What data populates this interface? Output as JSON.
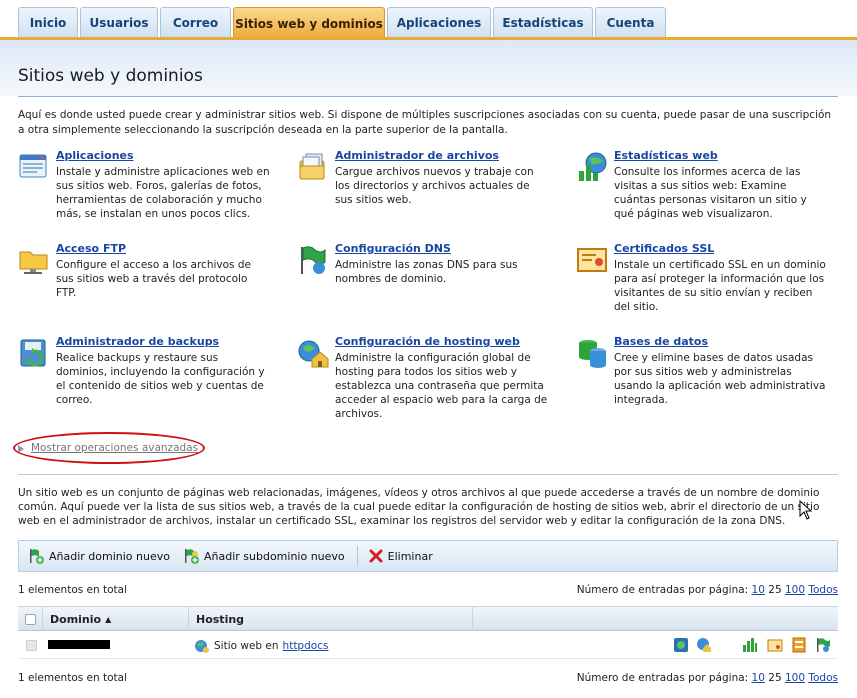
{
  "tabs": [
    {
      "label": "Inicio",
      "active": false
    },
    {
      "label": "Usuarios",
      "active": false
    },
    {
      "label": "Correo",
      "active": false
    },
    {
      "label": "Sitios web y dominios",
      "active": true
    },
    {
      "label": "Aplicaciones",
      "active": false
    },
    {
      "label": "Estadísticas",
      "active": false
    },
    {
      "label": "Cuenta",
      "active": false
    }
  ],
  "page_title": "Sitios web y dominios",
  "intro": "Aquí es donde usted puede crear y administrar sitios web. Si dispone de múltiples suscripciones asociadas con su cuenta, puede pasar de una suscripción a otra simplemente seleccionando la suscripción deseada en la parte superior de la pantalla.",
  "tiles": [
    {
      "title": "Aplicaciones",
      "icon": "applications-icon",
      "desc": "Instale y administre aplicaciones web en sus sitios web. Foros, galerías de fotos, herramientas de colaboración y mucho más, se instalan en unos pocos clics."
    },
    {
      "title": "Administrador de archivos",
      "icon": "file-manager-icon",
      "desc": "Cargue archivos nuevos y trabaje con los directorios y archivos actuales de sus sitios web."
    },
    {
      "title": "Estadísticas web",
      "icon": "web-statistics-icon",
      "desc": "Consulte los informes acerca de las visitas a sus sitios web: Examine cuántas personas visitaron un sitio y qué páginas web visualizaron."
    },
    {
      "title": "Acceso FTP",
      "icon": "ftp-folder-icon",
      "desc": "Configure el acceso a los archivos de sus sitios web a través del protocolo FTP."
    },
    {
      "title": "Configuración DNS",
      "icon": "dns-flag-icon",
      "desc": "Administre las zonas DNS para sus nombres de dominio."
    },
    {
      "title": "Certificados SSL",
      "icon": "ssl-certificate-icon",
      "desc": "Instale un certificado SSL en un dominio para así proteger la información que los visitantes de su sitio envían y reciben del sitio."
    },
    {
      "title": "Administrador de backups",
      "icon": "backup-icon",
      "desc": "Realice backups y restaure sus dominios, incluyendo la configuración y el contenido de sitios web y cuentas de correo."
    },
    {
      "title": "Configuración de hosting web",
      "icon": "hosting-settings-icon",
      "desc": "Administre la configuración global de hosting para todos los sitios web y establezca una contraseña que permita acceder al espacio web para la carga de archivos."
    },
    {
      "title": "Bases de datos",
      "icon": "database-icon",
      "desc": "Cree y elimine bases de datos usadas por sus sitios web y administrelas usando la aplicación web administrativa integrada."
    }
  ],
  "advanced_link": "Mostrar operaciones avanzadas",
  "domains_desc": "Un sitio web es un conjunto de páginas web relacionadas, imágenes, vídeos y otros archivos al que puede accederse a través de un nombre de dominio común. Aquí puede ver la lista de sus sitios web, a través de la cual puede editar la configuración de hosting de sitios web, abrir el directorio de un sitio web en el administrador de archivos, instalar un certificado SSL, examinar los registros del servidor web y editar la configuración de la zona DNS.",
  "toolbar": {
    "add_domain": "Añadir dominio nuevo",
    "add_subdomain": "Añadir subdominio nuevo",
    "delete": "Eliminar"
  },
  "count_text": "1 elementos en total",
  "per_page": {
    "label": "Número de entradas por página:",
    "options": [
      "10",
      "25",
      "100",
      "Todos"
    ],
    "current": "25"
  },
  "table": {
    "col_domain": "Dominio",
    "col_hosting": "Hosting",
    "rows": [
      {
        "hosting_prefix": "Sitio web en",
        "hosting_link": "httpdocs"
      }
    ]
  },
  "colors": {
    "accent_tab": "#eda93a",
    "link": "#1846a3",
    "annotation": "#d01010"
  }
}
